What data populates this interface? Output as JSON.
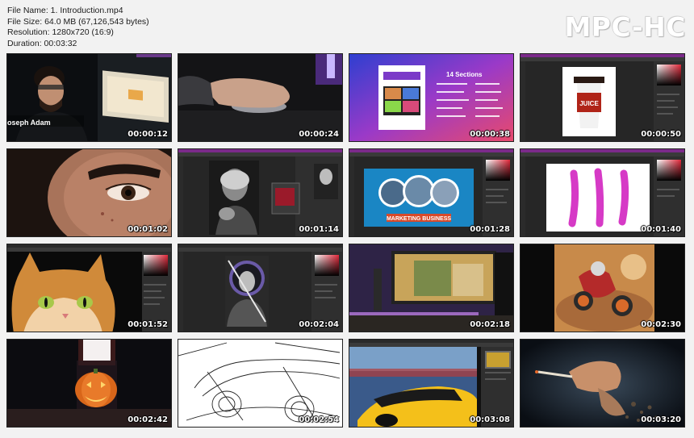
{
  "info": {
    "file_name": "File Name: 1. Introduction.mp4",
    "file_size": "File Size: 64.0 MB (67,126,543 bytes)",
    "resolution": "Resolution: 1280x720 (16:9)",
    "duration": "Duration: 00:03:32"
  },
  "logo": "MPC-HC",
  "thumbnails": [
    {
      "time": "00:00:12",
      "caption": "oseph Adam",
      "scene": "man-studio"
    },
    {
      "time": "00:00:24",
      "scene": "hand-mouse"
    },
    {
      "time": "00:00:38",
      "scene": "product-box",
      "heading": "14 Sections"
    },
    {
      "time": "00:00:50",
      "scene": "ps-cup",
      "cup_label": "JUICE"
    },
    {
      "time": "00:01:02",
      "scene": "eye-closeup"
    },
    {
      "time": "00:01:14",
      "scene": "ps-portrait"
    },
    {
      "time": "00:01:28",
      "scene": "ps-marketing",
      "banner": "MARKETING BUSINESS"
    },
    {
      "time": "00:01:40",
      "scene": "ps-brush"
    },
    {
      "time": "00:01:52",
      "scene": "ps-cat"
    },
    {
      "time": "00:02:04",
      "scene": "ps-astronaut"
    },
    {
      "time": "00:02:18",
      "scene": "monitor-room"
    },
    {
      "time": "00:02:30",
      "scene": "moto-desert"
    },
    {
      "time": "00:02:42",
      "scene": "pumpkin"
    },
    {
      "time": "00:02:54",
      "scene": "car-sketch"
    },
    {
      "time": "00:03:08",
      "scene": "ps-car"
    },
    {
      "time": "00:03:20",
      "scene": "hand-smoke"
    }
  ]
}
